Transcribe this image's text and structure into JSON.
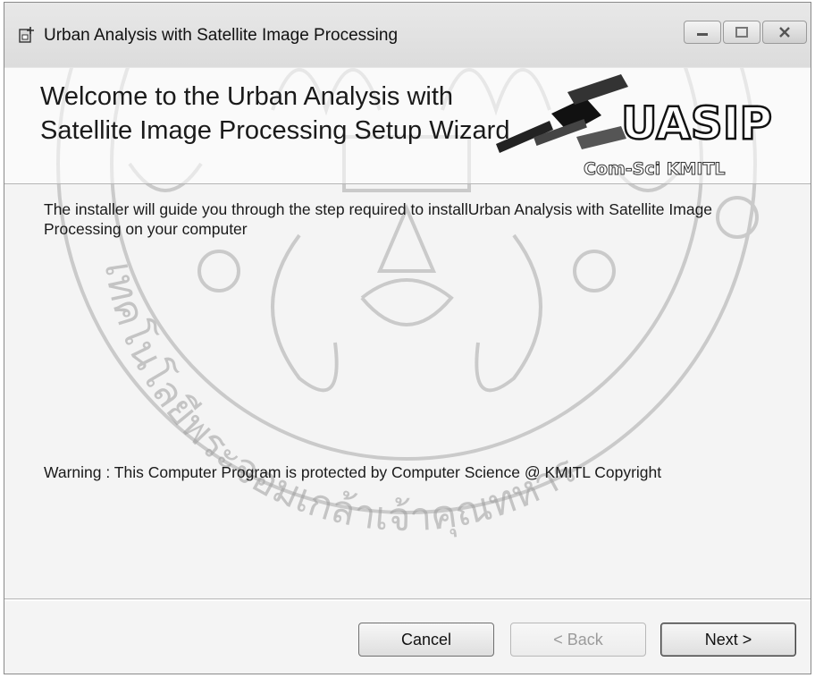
{
  "window": {
    "title": "Urban Analysis with Satellite Image Processing"
  },
  "banner": {
    "title": "Welcome to the Urban Analysis with Satellite Image Processing Setup Wizard",
    "logo_text": "UASIP",
    "logo_subtext": "Com-Sci KMITL"
  },
  "content": {
    "intro": "The installer will guide you through the step required to installUrban Analysis with Satellite Image Processing on your computer",
    "warning": "Warning : This Computer Program is protected by Computer Science @ KMITL Copyright"
  },
  "buttons": {
    "cancel": "Cancel",
    "back": "< Back",
    "next": "Next >"
  },
  "watermark": {
    "text": "เทคโนโลยีพระจอมเกล้าเจ้าคุณทหาร"
  },
  "icons": {
    "app": "installer-icon",
    "minimize": "minimize-icon",
    "maximize": "maximize-icon",
    "close": "close-icon",
    "satellite": "satellite-icon"
  },
  "colors": {
    "window_bg": "#f4f4f4",
    "watermark": "#9e9e9e",
    "text": "#1a1a1a"
  }
}
